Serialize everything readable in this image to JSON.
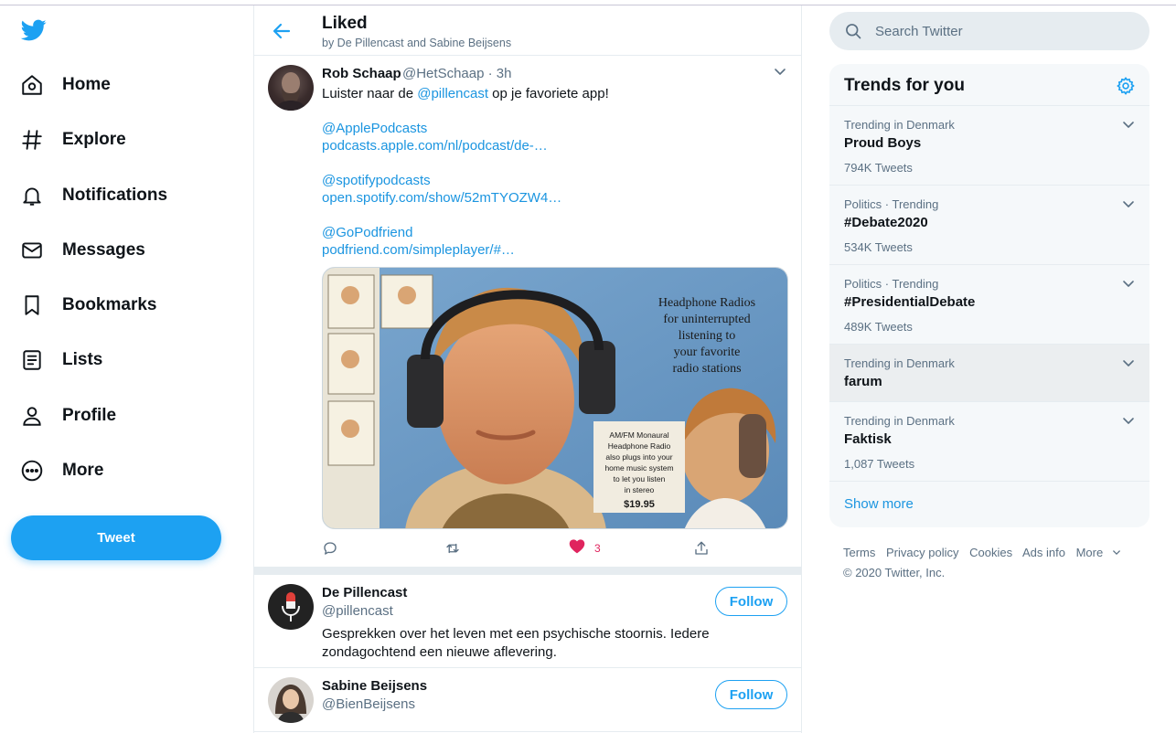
{
  "nav": {
    "items": [
      {
        "label": "Home"
      },
      {
        "label": "Explore"
      },
      {
        "label": "Notifications"
      },
      {
        "label": "Messages"
      },
      {
        "label": "Bookmarks"
      },
      {
        "label": "Lists"
      },
      {
        "label": "Profile"
      },
      {
        "label": "More"
      }
    ],
    "tweet_button": "Tweet"
  },
  "header": {
    "title": "Liked",
    "subtitle": "by De Pillencast and Sabine Beijsens"
  },
  "tweet": {
    "name": "Rob Schaap",
    "handle": "@HetSchaap · 3h",
    "text_prefix": "Luister naar de ",
    "text_mention": "@pillencast",
    "text_suffix": " op je favoriete app!",
    "lines": [
      "@ApplePodcasts",
      "podcasts.apple.com/nl/podcast/de-…",
      "@spotifypodcasts",
      "open.spotify.com/show/52mTYOZW4…",
      "@GoPodfriend",
      "podfriend.com/simpleplayer/#…"
    ],
    "media_text": {
      "headline_lines": [
        "Headphone Radios",
        "for uninterrupted",
        "listening to",
        "your favorite",
        "radio stations"
      ],
      "box_lines": [
        "AM/FM Monaural",
        "Headphone Radio",
        "also plugs into your",
        "home music system",
        "to let you listen",
        "in stereo",
        "$19.95"
      ]
    },
    "like_count": "3"
  },
  "users": [
    {
      "name": "De Pillencast",
      "handle": "@pillencast",
      "bio": "Gesprekken over het leven met een psychische stoornis. Iedere zondagochtend een nieuwe aflevering.",
      "follow": "Follow"
    },
    {
      "name": "Sabine Beijsens",
      "handle": "@BienBeijsens",
      "follow": "Follow"
    }
  ],
  "search": {
    "placeholder": "Search Twitter"
  },
  "trends": {
    "title": "Trends for you",
    "items": [
      {
        "meta": "Trending in Denmark",
        "name": "Proud Boys",
        "count": "794K Tweets"
      },
      {
        "meta": "Politics · Trending",
        "name": "#Debate2020",
        "count": "534K Tweets"
      },
      {
        "meta": "Politics · Trending",
        "name": "#PresidentialDebate",
        "count": "489K Tweets"
      },
      {
        "meta": "Trending in Denmark",
        "name": "farum",
        "count": ""
      },
      {
        "meta": "Trending in Denmark",
        "name": "Faktisk",
        "count": "1,087 Tweets"
      }
    ],
    "show_more": "Show more"
  },
  "footer": {
    "links": [
      "Terms",
      "Privacy policy",
      "Cookies",
      "Ads info",
      "More"
    ],
    "copyright": "© 2020 Twitter, Inc."
  },
  "colors": {
    "accent": "#1da1f2",
    "link": "#1b95e0",
    "like": "#e0245e",
    "muted": "#5b7083"
  }
}
